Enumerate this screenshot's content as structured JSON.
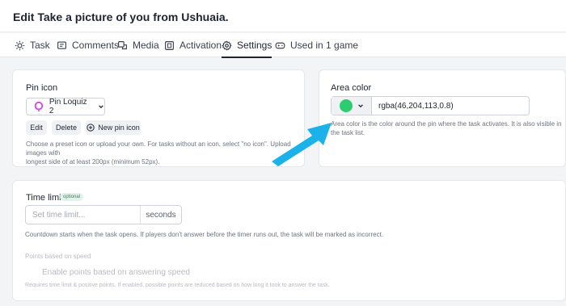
{
  "header": {
    "title": "Edit Take a picture of you from Ushuaia."
  },
  "tabs": [
    {
      "label": "Task",
      "icon": "sun-gear-icon"
    },
    {
      "label": "Comments",
      "icon": "comment-icon"
    },
    {
      "label": "Media",
      "icon": "media-icon"
    },
    {
      "label": "Activation",
      "icon": "activation-icon"
    },
    {
      "label": "Settings",
      "icon": "gear-icon",
      "active": true
    },
    {
      "label": "Used in 1 game",
      "icon": "game-icon"
    }
  ],
  "pin_icon": {
    "title": "Pin icon",
    "selected": "Pin Loquiz 2",
    "edit_label": "Edit",
    "delete_label": "Delete",
    "new_label": "New pin icon",
    "help_line1": "Choose a preset icon or upload your own. For tasks without an icon, select \"no icon\". Upload images with",
    "help_line2": "longest side of at least 200px (minimum 52px).",
    "accent_color": "#d946ef"
  },
  "area_color": {
    "title": "Area color",
    "value": "rgba(46,204,113,0.8)",
    "swatch_color": "#2ecc71",
    "help": "Area color is the color around the pin where the task activates. It is also visible in the task list."
  },
  "time_limit": {
    "title": "Time limit",
    "badge": "optional",
    "placeholder": "Set time limit...",
    "unit": "seconds",
    "help": "Countdown starts when the task opens. If players don't answer before the timer runs out, the task will be marked as incorrect.",
    "points_title": "Points based on speed",
    "points_toggle_label": "Enable points based on answering speed",
    "points_help": "Requires time limit & positive points. If enabled, possible points are reduced based on how long it took to answer the task."
  },
  "arrow_color": "#1ab2e8"
}
